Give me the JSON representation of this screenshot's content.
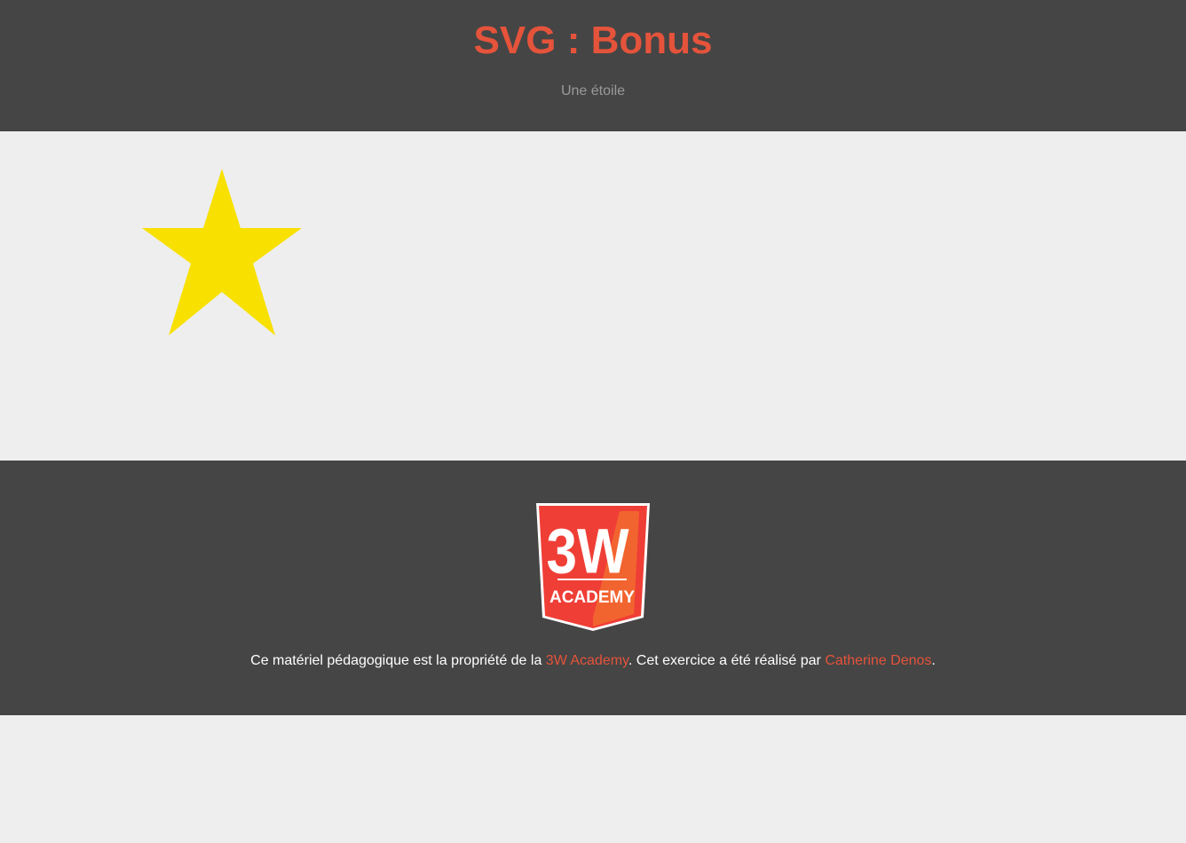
{
  "header": {
    "title": "SVG : Bonus",
    "subtitle": "Une étoile"
  },
  "main": {
    "star_color": "#f8e000"
  },
  "footer": {
    "logo_text_main": "3W",
    "logo_text_sub": "ACADEMY",
    "credits_prefix": "Ce matériel pédagogique est la propriété de la ",
    "academy_link": "3W Academy",
    "credits_middle": ". Cet exercice a été réalisé par ",
    "author_link": "Catherine Denos",
    "credits_suffix": "."
  },
  "colors": {
    "header_bg": "#454545",
    "accent": "#e5533b",
    "page_bg": "#eeeeee",
    "logo_red": "#ef3e36"
  }
}
